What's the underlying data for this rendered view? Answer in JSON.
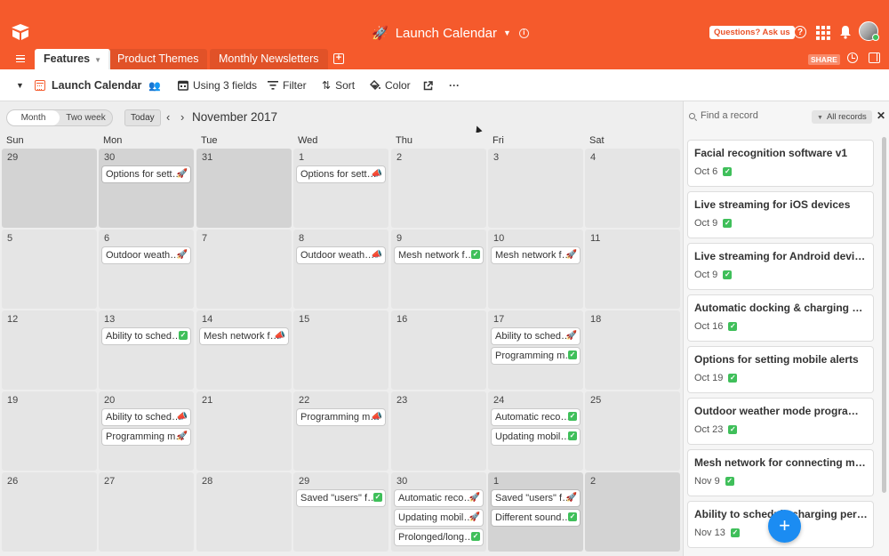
{
  "header": {
    "base_title": "Launch Calendar",
    "help_label": "Questions? Ask us",
    "help_icon_glyph": "?",
    "share_label": "SHARE",
    "brand_color": "#f55a2c"
  },
  "tabs": [
    {
      "label": "Features",
      "active": true
    },
    {
      "label": "Product Themes",
      "active": false
    },
    {
      "label": "Monthly Newsletters",
      "active": false
    }
  ],
  "add_tab_glyph": "+",
  "toolbar": {
    "view_name": "Launch Calendar",
    "fields_label": "Using 3 fields",
    "filter_label": "Filter",
    "sort_label": "Sort",
    "color_label": "Color",
    "more_label": "···"
  },
  "calendar_nav": {
    "modes": [
      "Month",
      "Two week"
    ],
    "selected_mode": "Month",
    "today_label": "Today",
    "month_label": "November 2017"
  },
  "weekdays": [
    "Sun",
    "Mon",
    "Tue",
    "Wed",
    "Thu",
    "Fri",
    "Sat"
  ],
  "weeks": [
    [
      {
        "day": "29",
        "out": true,
        "events": []
      },
      {
        "day": "30",
        "out": true,
        "events": [
          {
            "title": "Options for sett…",
            "status": "rocket"
          }
        ]
      },
      {
        "day": "31",
        "out": true,
        "events": []
      },
      {
        "day": "1",
        "out": false,
        "events": [
          {
            "title": "Options for sett…",
            "status": "megaphone"
          }
        ]
      },
      {
        "day": "2",
        "out": false,
        "events": []
      },
      {
        "day": "3",
        "out": false,
        "events": []
      },
      {
        "day": "4",
        "out": false,
        "events": []
      }
    ],
    [
      {
        "day": "5",
        "out": false,
        "events": []
      },
      {
        "day": "6",
        "out": false,
        "events": [
          {
            "title": "Outdoor weath…",
            "status": "rocket"
          }
        ]
      },
      {
        "day": "7",
        "out": false,
        "events": []
      },
      {
        "day": "8",
        "out": false,
        "events": [
          {
            "title": "Outdoor weath…",
            "status": "megaphone"
          }
        ]
      },
      {
        "day": "9",
        "out": false,
        "events": [
          {
            "title": "Mesh network f…",
            "status": "check"
          }
        ]
      },
      {
        "day": "10",
        "out": false,
        "events": [
          {
            "title": "Mesh network f…",
            "status": "rocket"
          }
        ]
      },
      {
        "day": "11",
        "out": false,
        "events": []
      }
    ],
    [
      {
        "day": "12",
        "out": false,
        "events": []
      },
      {
        "day": "13",
        "out": false,
        "events": [
          {
            "title": "Ability to sched…",
            "status": "check"
          }
        ]
      },
      {
        "day": "14",
        "out": false,
        "events": [
          {
            "title": "Mesh network f…",
            "status": "megaphone"
          }
        ]
      },
      {
        "day": "15",
        "out": false,
        "events": []
      },
      {
        "day": "16",
        "out": false,
        "events": []
      },
      {
        "day": "17",
        "out": false,
        "events": [
          {
            "title": "Ability to sched…",
            "status": "rocket"
          },
          {
            "title": "Programming m…",
            "status": "check"
          }
        ]
      },
      {
        "day": "18",
        "out": false,
        "events": []
      }
    ],
    [
      {
        "day": "19",
        "out": false,
        "events": []
      },
      {
        "day": "20",
        "out": false,
        "events": [
          {
            "title": "Ability to sched…",
            "status": "megaphone"
          },
          {
            "title": "Programming m…",
            "status": "rocket"
          }
        ]
      },
      {
        "day": "21",
        "out": false,
        "events": []
      },
      {
        "day": "22",
        "out": false,
        "events": [
          {
            "title": "Programming m…",
            "status": "megaphone"
          }
        ]
      },
      {
        "day": "23",
        "out": false,
        "events": []
      },
      {
        "day": "24",
        "out": false,
        "events": [
          {
            "title": "Automatic reco…",
            "status": "check"
          },
          {
            "title": "Updating mobil…",
            "status": "check"
          }
        ]
      },
      {
        "day": "25",
        "out": false,
        "events": []
      }
    ],
    [
      {
        "day": "26",
        "out": false,
        "events": []
      },
      {
        "day": "27",
        "out": false,
        "events": []
      },
      {
        "day": "28",
        "out": false,
        "events": []
      },
      {
        "day": "29",
        "out": false,
        "events": [
          {
            "title": "Saved \"users\" f…",
            "status": "check"
          }
        ]
      },
      {
        "day": "30",
        "out": false,
        "events": [
          {
            "title": "Automatic reco…",
            "status": "rocket"
          },
          {
            "title": "Updating mobil…",
            "status": "rocket"
          },
          {
            "title": "Prolonged/long…",
            "status": "check"
          }
        ]
      },
      {
        "day": "1",
        "out": true,
        "events": [
          {
            "title": "Saved \"users\" f…",
            "status": "rocket"
          },
          {
            "title": "Different sound…",
            "status": "check"
          }
        ]
      },
      {
        "day": "2",
        "out": true,
        "events": []
      }
    ]
  ],
  "status_glyphs": {
    "rocket": "🚀",
    "megaphone": "📣",
    "check": "✓"
  },
  "sidebar": {
    "search_placeholder": "Find a record",
    "filter_label": "All records",
    "close_glyph": "✕",
    "records": [
      {
        "title": "Facial recognition software v1",
        "date": "Oct 6"
      },
      {
        "title": "Live streaming for iOS devices",
        "date": "Oct 9"
      },
      {
        "title": "Live streaming for Android devices",
        "date": "Oct 9"
      },
      {
        "title": "Automatic docking & charging at l…",
        "date": "Oct 16"
      },
      {
        "title": "Options for setting mobile alerts",
        "date": "Oct 19"
      },
      {
        "title": "Outdoor weather mode programm…",
        "date": "Oct 23"
      },
      {
        "title": "Mesh network for connecting mult…",
        "date": "Nov 9"
      },
      {
        "title": "Ability to schedule charging perio…",
        "date": "Nov 13"
      }
    ]
  },
  "fab_glyph": "+"
}
